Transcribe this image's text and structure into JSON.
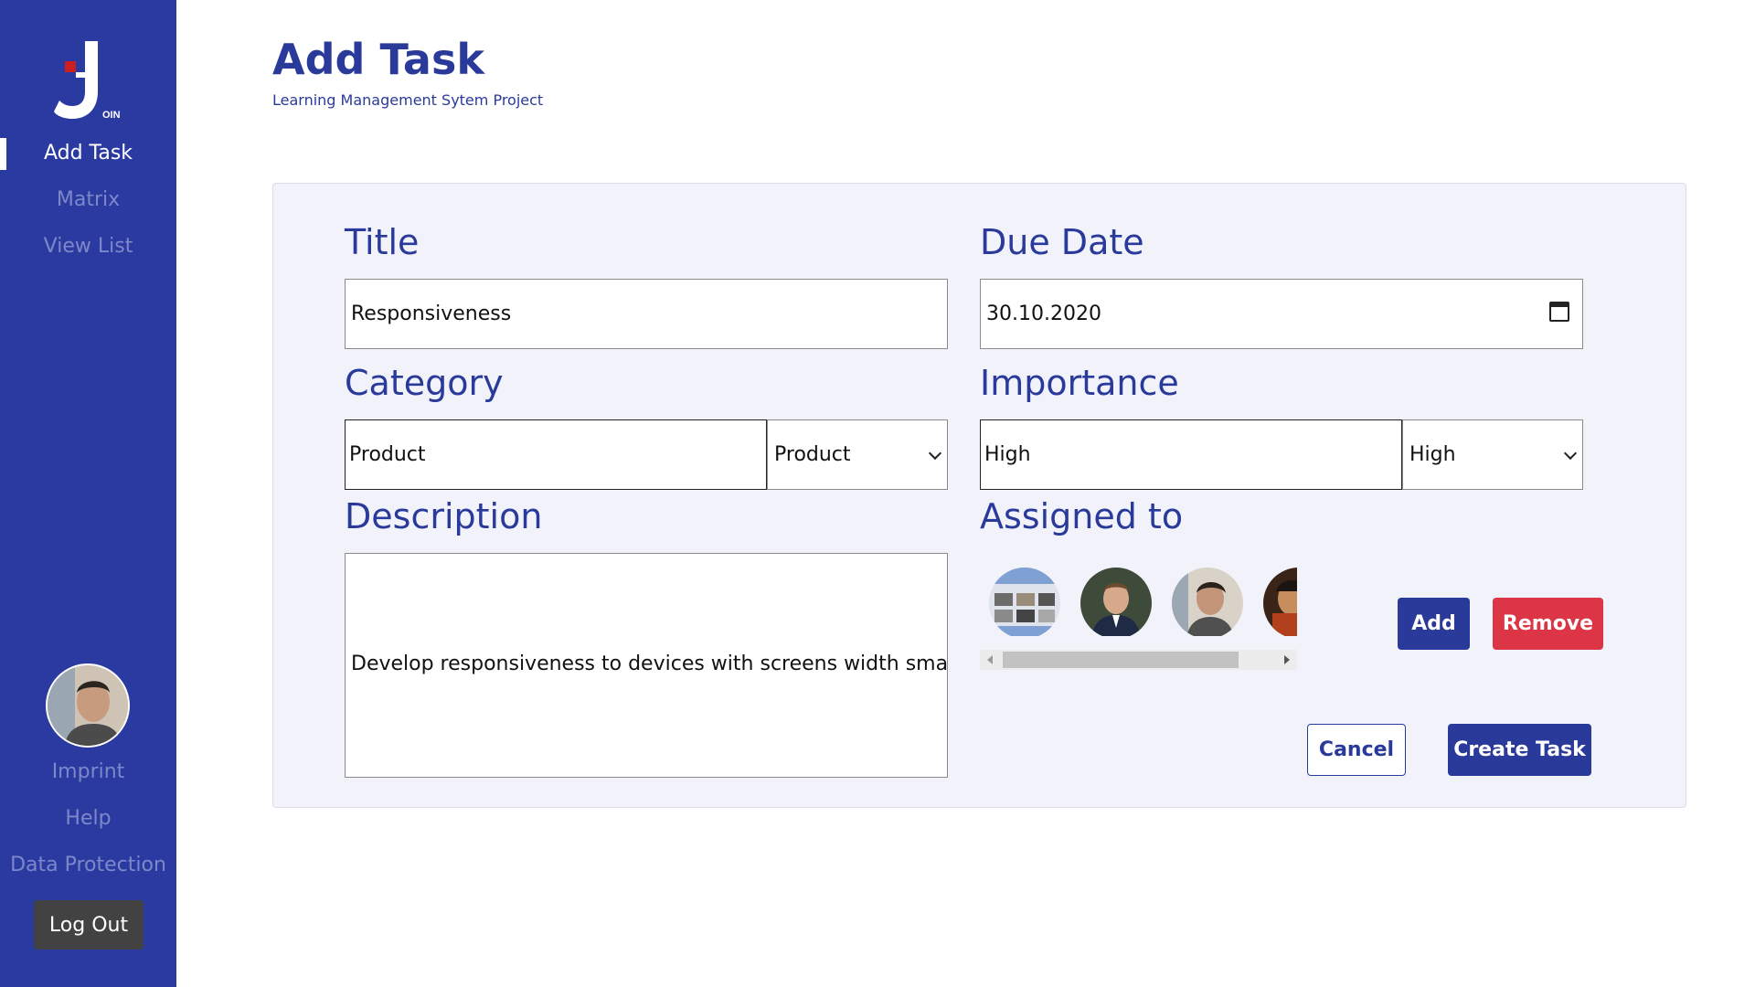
{
  "sidebar": {
    "logo_text": "OIN",
    "nav": [
      {
        "label": "Add Task",
        "active": true
      },
      {
        "label": "Matrix",
        "active": false
      },
      {
        "label": "View List",
        "active": false
      }
    ],
    "footer_links": [
      "Imprint",
      "Help",
      "Data Protection"
    ],
    "logout_label": "Log Out",
    "colors": {
      "background": "#2a3aa1",
      "active": "#ffffff",
      "inactive": "#7d88c9"
    }
  },
  "header": {
    "title": "Add Task",
    "subtitle": "Learning Management Sytem Project"
  },
  "form": {
    "title": {
      "label": "Title",
      "value": "Responsiveness"
    },
    "due_date": {
      "label": "Due Date",
      "value": "30.10.2020",
      "icon": "calendar-icon"
    },
    "category": {
      "label": "Category",
      "value": "Product",
      "selected": "Product"
    },
    "importance": {
      "label": "Importance",
      "value": "High",
      "selected": "High"
    },
    "description": {
      "label": "Description",
      "value": "Develop responsiveness to devices with screens width smaller t"
    },
    "assigned": {
      "label": "Assigned to",
      "avatars": [
        "avatar-1",
        "avatar-2",
        "avatar-3",
        "avatar-4"
      ]
    },
    "add_label": "Add",
    "remove_label": "Remove",
    "cancel_label": "Cancel",
    "create_label": "Create Task"
  },
  "colors": {
    "primary": "#2a3a9a",
    "danger": "#dc3545",
    "card_bg": "#f2f2fa"
  }
}
